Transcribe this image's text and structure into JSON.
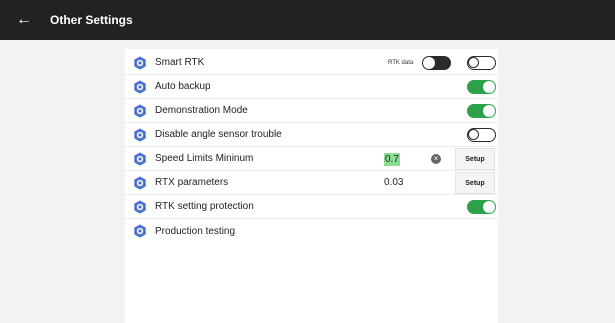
{
  "header": {
    "title": "Other Settings",
    "back_icon": "arrow-left-icon"
  },
  "accent_color": "#2ea04a",
  "rows": [
    {
      "label": "Smart RTK",
      "rtk_data_label": "RTK data",
      "rtk_data_on": true,
      "toggle_on": false
    },
    {
      "label": "Auto backup",
      "toggle_on": true
    },
    {
      "label": "Demonstration Mode",
      "toggle_on": true
    },
    {
      "label": "Disable angle sensor trouble",
      "toggle_on": false
    },
    {
      "label": "Speed Limits Mininum",
      "value": "0.7",
      "button": "Setup"
    },
    {
      "label": "RTX parameters",
      "value": "0.03",
      "button": "Setup"
    },
    {
      "label": "RTK setting protection",
      "toggle_on": true
    },
    {
      "label": "Production testing"
    }
  ]
}
